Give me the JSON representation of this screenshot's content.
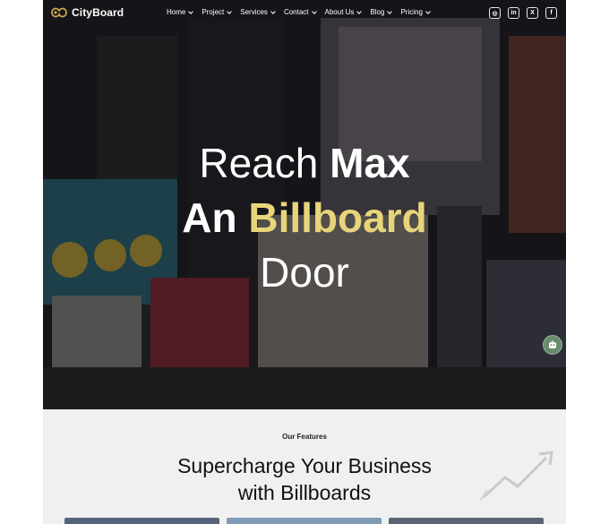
{
  "brand": {
    "name": "CityBoard"
  },
  "nav": {
    "items": [
      {
        "label": "Home"
      },
      {
        "label": "Project"
      },
      {
        "label": "Services"
      },
      {
        "label": "Contact"
      },
      {
        "label": "About Us"
      },
      {
        "label": "Blog"
      },
      {
        "label": "Pricing"
      }
    ]
  },
  "socials": [
    {
      "name": "instagram-icon",
      "glyph": "◎"
    },
    {
      "name": "linkedin-icon",
      "glyph": "in"
    },
    {
      "name": "x-icon",
      "glyph": "X"
    },
    {
      "name": "facebook-icon",
      "glyph": "f"
    }
  ],
  "hero": {
    "line1_light": "Reach ",
    "line1_bold": "Max",
    "line2_bold": "An ",
    "line2_accent": "Billboard",
    "line3": "Door",
    "accent_color": "#e8d57a"
  },
  "features": {
    "label": "Our Features",
    "title_line1": "Supercharge Your Business",
    "title_line2": "with Billboards"
  }
}
